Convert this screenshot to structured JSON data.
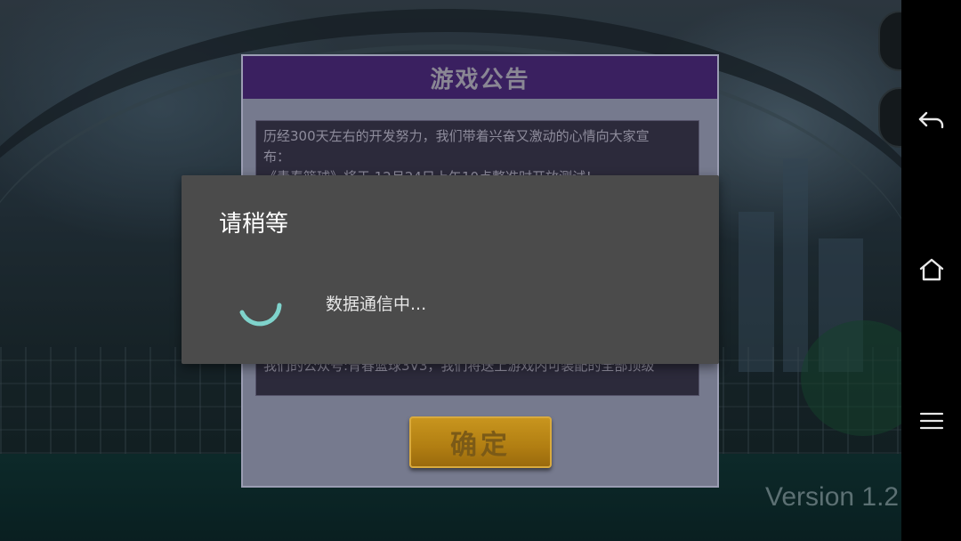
{
  "notice": {
    "title": "游戏公告",
    "lines": [
      "历经300天左右的开发努力，我们带着兴奋又激动的心情向大家宣",
      "布：",
      "《青春篮球》将于 12月24日上午10点整准时开放测试！"
    ],
    "bottom_line": "我们的公众号:青春篮球3V3，我们将送上游戏内可装配的全部顶级",
    "confirm_label": "确定"
  },
  "dialog": {
    "title": "请稍等",
    "message": "数据通信中..."
  },
  "version_text": "Version 1.2",
  "nav": {
    "back_icon": "back-arrow-icon",
    "home_icon": "home-icon",
    "menu_icon": "menu-icon"
  },
  "colors": {
    "panel_header": "#3a2060",
    "confirm_button": "#b17e12",
    "dialog_bg": "#4b4b4b",
    "spinner": "#7fd3cc"
  }
}
